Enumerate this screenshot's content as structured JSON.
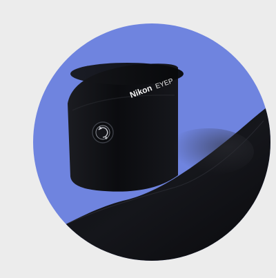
{
  "image": {
    "background_color": "#ececec",
    "circle_color": "#6f84df",
    "device_color": "#111216",
    "eyepiece_brand_text": "Nikon",
    "eyepiece_model_text": "EYEP",
    "icon": "adjustment-dial-icon"
  }
}
